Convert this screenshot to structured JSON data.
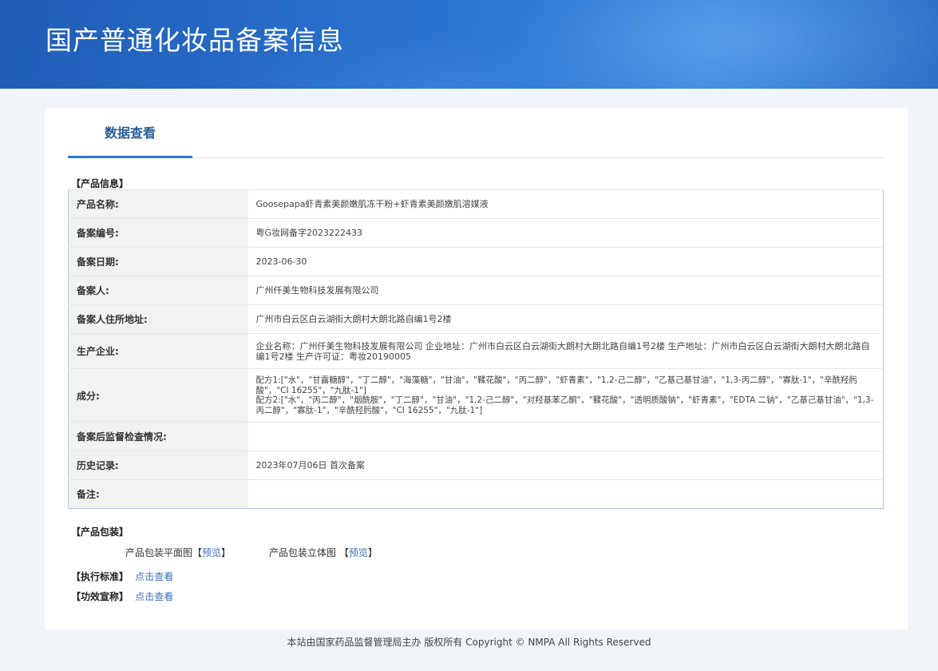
{
  "header": {
    "title": "国产普通化妆品备案信息"
  },
  "tabs": [
    {
      "label": "数据查看"
    }
  ],
  "product_info": {
    "section_label": "【产品信息】",
    "rows": [
      {
        "label": "产品名称:",
        "value": "Goosepapa虾青素美颜嫩肌冻干粉+虾青素美颜嫩肌溶媒液"
      },
      {
        "label": "备案编号:",
        "value": "粤G妆网备字2023222433"
      },
      {
        "label": "备案日期:",
        "value": "2023-06-30"
      },
      {
        "label": "备案人:",
        "value": "广州仟美生物科技发展有限公司"
      },
      {
        "label": "备案人住所地址:",
        "value": "广州市白云区白云湖街大朗村大朗北路自编1号2楼"
      },
      {
        "label": "生产企业:",
        "value": "企业名称：广州仟美生物科技发展有限公司 企业地址：广州市白云区白云湖街大朗村大朗北路自编1号2楼 生产地址：广州市白云区白云湖街大朗村大朗北路自编1号2楼 生产许可证：粤妆20190005"
      },
      {
        "label": "成分:",
        "value": "配方1:[\"水\"，\"甘露糖醇\"，\"丁二醇\"，\"海藻糖\"，\"甘油\"，\"鞣花酸\"，\"丙二醇\"，\"虾青素\"，\"1,2-己二醇\"，\"乙基己基甘油\"，\"1,3-丙二醇\"，\"寡肽-1\"，\"辛酰羟肟酸\"，\"CI 16255\"，\"九肽-1\"]\n配方2:[\"水\"，\"丙二醇\"，\"烟酰胺\"，\"丁二醇\"，\"甘油\"，\"1,2-己二醇\"，\"对羟基苯乙酮\"，\"鞣花酸\"，\"透明质酸钠\"，\"虾青素\"，\"EDTA 二钠\"，\"乙基己基甘油\"，\"1,3-丙二醇\"，\"寡肽-1\"，\"辛酰羟肟酸\"，\"CI 16255\"，\"九肽-1\"]"
      },
      {
        "label": "备案后监督检查情况:",
        "value": ""
      },
      {
        "label": "历史记录:",
        "value": "2023年07月06日 首次备案"
      },
      {
        "label": "备注:",
        "value": ""
      }
    ]
  },
  "packaging": {
    "section_label": "【产品包装】",
    "flat_label": "产品包装平面图",
    "solid_label": "产品包装立体图",
    "bracket_open": "【",
    "bracket_close": "】",
    "preview_link": "预览"
  },
  "standard": {
    "section_label": "【执行标准】",
    "link": "点击查看"
  },
  "efficacy": {
    "section_label": "【功效宣称】",
    "link": "点击查看"
  },
  "footer": {
    "text": "本站由国家药品监督管理局主办 版权所有 Copyright © NMPA All Rights Reserved"
  }
}
